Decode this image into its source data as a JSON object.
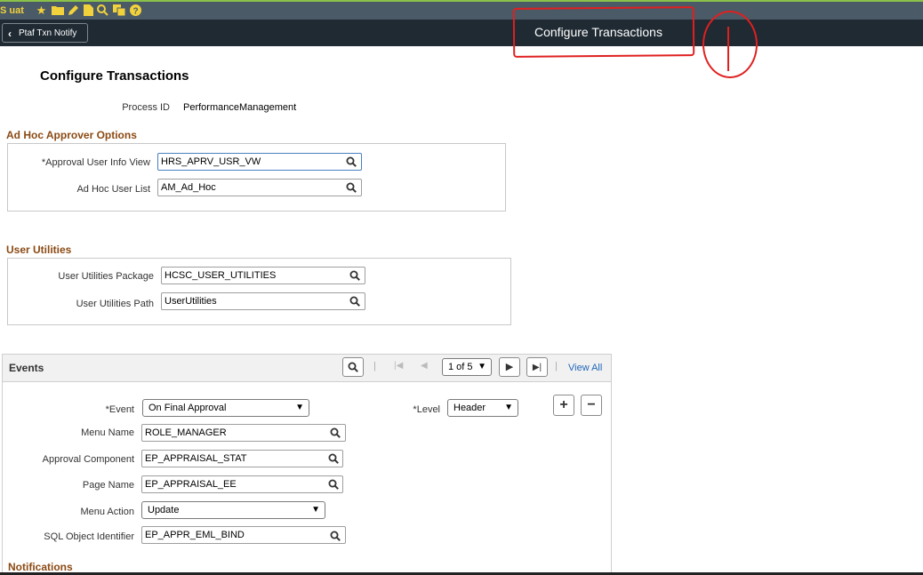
{
  "env": {
    "label": "S uat"
  },
  "nav": {
    "back_label": "Ptaf Txn Notify",
    "title": "Configure Transactions"
  },
  "page": {
    "title": "Configure Transactions",
    "process_id_label": "Process ID",
    "process_id_value": "PerformanceManagement"
  },
  "adhoc": {
    "section": "Ad Hoc Approver Options",
    "approval_view_label": "*Approval User Info View",
    "approval_view_value": "HRS_APRV_USR_VW",
    "user_list_label": "Ad Hoc User List",
    "user_list_value": "AM_Ad_Hoc"
  },
  "utilities": {
    "section": "User Utilities",
    "package_label": "User Utilities Package",
    "package_value": "HCSC_USER_UTILITIES",
    "path_label": "User Utilities Path",
    "path_value": "UserUtilities"
  },
  "events": {
    "title": "Events",
    "pager": "1 of 5",
    "view_all": "View All",
    "event_label": "*Event",
    "event_value": "On Final Approval",
    "level_label": "*Level",
    "level_value": "Header",
    "menu_name_label": "Menu Name",
    "menu_name_value": "ROLE_MANAGER",
    "approval_component_label": "Approval Component",
    "approval_component_value": "EP_APPRAISAL_STAT",
    "page_name_label": "Page Name",
    "page_name_value": "EP_APPRAISAL_EE",
    "menu_action_label": "Menu Action",
    "menu_action_value": "Update",
    "sql_label": "SQL Object Identifier",
    "sql_value": "EP_APPR_EML_BIND",
    "notifications": "Notifications"
  },
  "colors": {
    "section": "#8b4a14",
    "link": "#2067b8",
    "nav": "#1f2a33",
    "annotation": "#e02020"
  }
}
